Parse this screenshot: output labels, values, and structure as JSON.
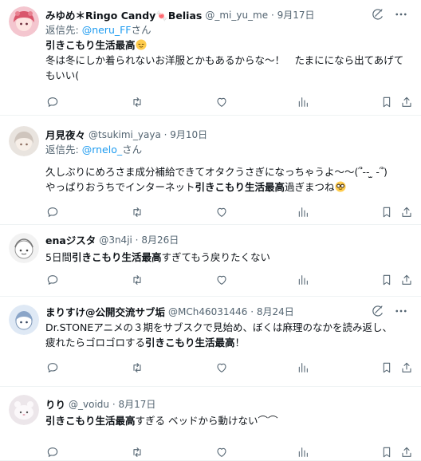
{
  "tweets": [
    {
      "name": "みゆめ＊Ringo Candy🍬Belias",
      "handle": "@_mi_yu_me",
      "date": "9月17日",
      "reply_prefix": "返信先: ",
      "reply_handle": "@neru_FF",
      "reply_suffix": "さん",
      "line1_bold": "引きこもり生活最高",
      "line2": "冬は冬にしか着られないお洋服とかもあるからな〜！　たまにになら出てあげてもいい("
    },
    {
      "name": "月見夜々",
      "handle": "@tsukimi_yaya",
      "date": "9月10日",
      "reply_prefix": "返信先: ",
      "reply_handle": "@rnelo_",
      "reply_suffix": "さん",
      "line1": "久しぶりにめろさま成分補給できてオタクうさぎになっちゃうよ〜〜(՞-- ̫ -՞)",
      "line2_pre": "やっぱりおうちでインターネット",
      "line2_bold": "引きこもり生活最高",
      "line2_post": "過ぎまつね"
    },
    {
      "name": "enaジスタ",
      "handle": "@3n4ji",
      "date": "8月26日",
      "text_pre": "5日間",
      "text_bold": "引きこもり生活最高",
      "text_post": "すぎてもう戻りたくない"
    },
    {
      "name": "まりすけ@公開交流サブ垢",
      "handle": "@MCh46031446",
      "date": "8月24日",
      "line1": "Dr.STONEアニメの３期をサブスクで見始め、ぼくは麻理のなかを読み返し、",
      "line2_pre": "疲れたらゴロゴロする",
      "line2_bold": "引きこもり生活最高",
      "line2_post": "！"
    },
    {
      "name": "りり",
      "handle": "@_voidu",
      "date": "8月17日",
      "text_bold": "引きこもり生活最高",
      "text_post": "すぎる ベッドから動けない⌒⌒"
    }
  ],
  "separator": " · ",
  "icons": {
    "grok": "grok-icon",
    "more": "more-icon",
    "reply": "reply-icon",
    "retweet": "retweet-icon",
    "like": "like-icon",
    "views": "views-icon",
    "bookmark": "bookmark-icon",
    "share": "share-icon"
  },
  "colors": {
    "text": "#0f1419",
    "secondary": "#536471",
    "link": "#1d9bf0",
    "divider": "#eff3f4"
  }
}
